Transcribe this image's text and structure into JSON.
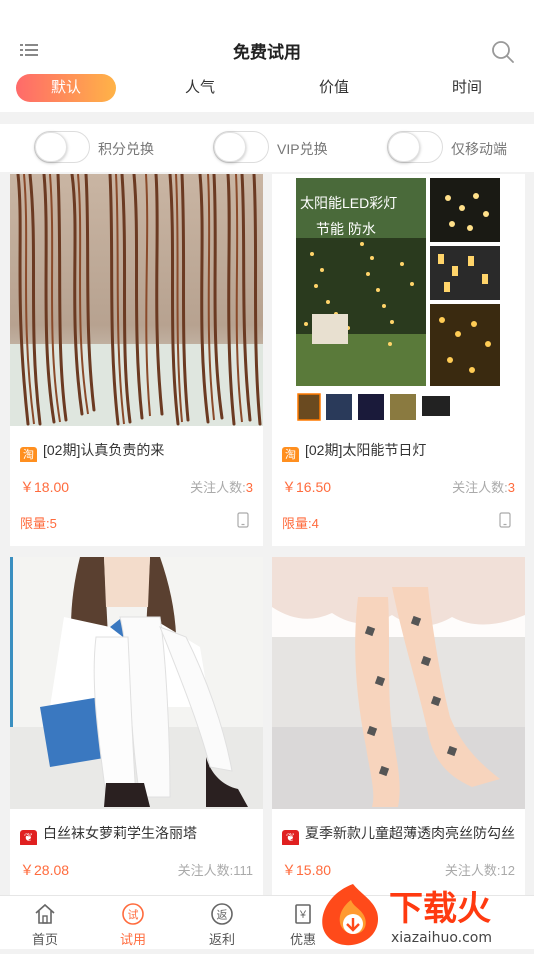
{
  "header": {
    "title": "免费试用",
    "menu_icon": "list-icon",
    "search_icon": "search-icon"
  },
  "tabs": [
    {
      "label": "默认",
      "active": true
    },
    {
      "label": "人气",
      "active": false
    },
    {
      "label": "价值",
      "active": false
    },
    {
      "label": "时间",
      "active": false
    }
  ],
  "filters": [
    {
      "label": "积分兑换",
      "on": false
    },
    {
      "label": "VIP兑换",
      "on": false
    },
    {
      "label": "仅移动端",
      "on": false
    }
  ],
  "products": [
    {
      "source": "淘",
      "title": "[02期]认真负责的来",
      "price": "￥18.00",
      "follow_label": "关注人数:",
      "follow_count": "3",
      "limit": "限量:5",
      "image": "brown-branches-photo"
    },
    {
      "source": "淘",
      "title": "[02期]太阳能节日灯",
      "price": "￥16.50",
      "follow_label": "关注人数:",
      "follow_count": "3",
      "limit": "限量:4",
      "image": "solar-string-lights-photo",
      "image_text": "太阳能LED彩灯 节能 防水"
    },
    {
      "source": "天猫",
      "title": "白丝袜女萝莉学生洛丽塔",
      "price": "￥28.08",
      "follow_label": "关注人数:",
      "follow_count": "111",
      "limit": "",
      "image": "white-stockings-photo"
    },
    {
      "source": "天猫",
      "title": "夏季新款儿童超薄透肉亮丝防勾丝",
      "price": "￥15.80",
      "follow_label": "关注人数:",
      "follow_count": "12",
      "limit": "",
      "image": "kids-tights-photo"
    }
  ],
  "bottom_nav": [
    {
      "label": "首页",
      "icon": "home-icon",
      "active": false
    },
    {
      "label": "试用",
      "icon": "trial-icon",
      "icon_char": "试",
      "active": true
    },
    {
      "label": "返利",
      "icon": "rebate-icon",
      "icon_char": "返",
      "active": false
    },
    {
      "label": "优惠",
      "icon": "coupon-icon",
      "icon_char": "￥",
      "active": false
    }
  ],
  "watermark": {
    "text": "下载火",
    "url": "xiazaihuo.com"
  },
  "colors": {
    "accent": "#ff6b3d",
    "tab_gradient_start": "#ff6a6a",
    "tab_gradient_end": "#ffb347",
    "taobao": "#ff8f1f",
    "tmall": "#e02020"
  }
}
